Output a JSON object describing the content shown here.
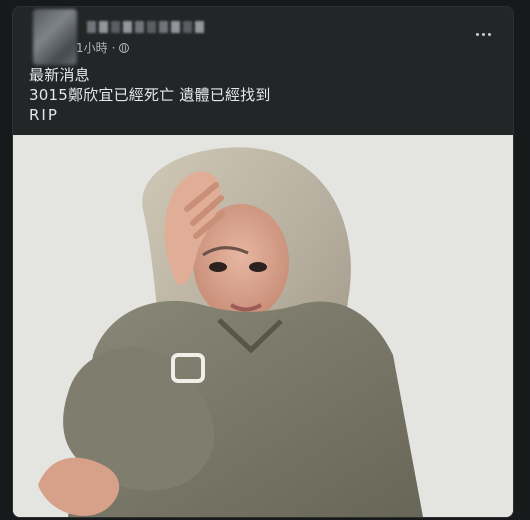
{
  "post": {
    "time": "1小時",
    "separator": "·",
    "privacy_icon": "globe-icon",
    "more_icon": "more-options-icon",
    "text_lines": [
      "最新消息",
      "3015鄭欣宜已經死亡  遺體已經找到",
      "RIP"
    ],
    "image": {
      "description_icon": "post-photo",
      "background_color": "#e8e8e6"
    }
  }
}
